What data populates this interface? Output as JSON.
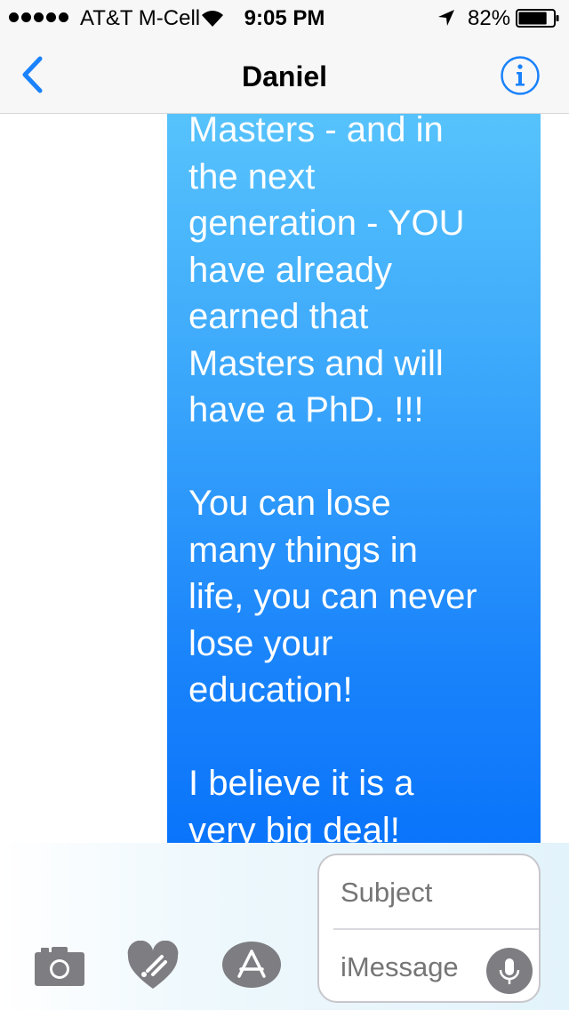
{
  "status_bar": {
    "carrier": "AT&T M-Cell",
    "time": "9:05 PM",
    "battery": "82%",
    "battery_level": 0.82
  },
  "nav": {
    "title": "Daniel",
    "back_icon": "chevron-left-icon",
    "info_icon": "info-circle-icon",
    "accent_color": "#1a82fb"
  },
  "messages": [
    {
      "sender": "me",
      "lines": [
        "Masters - and in",
        "the next",
        "generation - YOU",
        "have already",
        "earned that",
        "Masters and will",
        "have a PhD. !!!",
        "",
        "You can lose",
        "many things in",
        "life, you can never",
        "lose your",
        "education!",
        "",
        "I believe it is a",
        "very big deal!"
      ]
    }
  ],
  "compose": {
    "subject_placeholder": "Subject",
    "message_placeholder": "iMessage",
    "icons": [
      "camera-icon",
      "digital-touch-heart-icon",
      "app-store-icon",
      "microphone-icon"
    ]
  }
}
